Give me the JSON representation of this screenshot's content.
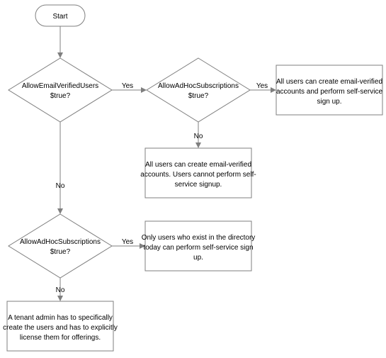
{
  "chart_data": {
    "type": "flowchart",
    "nodes": [
      {
        "id": "start",
        "kind": "terminator",
        "label": "Start"
      },
      {
        "id": "d1",
        "kind": "decision",
        "label": "AllowEmailVerifiedUsers $true?"
      },
      {
        "id": "d2",
        "kind": "decision",
        "label": "AllowAdHocSubscriptions $true?"
      },
      {
        "id": "d3",
        "kind": "decision",
        "label": "AllowAdHocSubscriptions $true?"
      },
      {
        "id": "o1",
        "kind": "outcome",
        "label": "All users can create email-verified accounts and perform self-service sign up."
      },
      {
        "id": "o2",
        "kind": "outcome",
        "label": "All users can create email-verified accounts. Users cannot perform self-service signup."
      },
      {
        "id": "o3",
        "kind": "outcome",
        "label": "Only users who exist in the directory today can perform self-service sign up."
      },
      {
        "id": "o4",
        "kind": "outcome",
        "label": "A tenant admin has to specifically create the users and has to explicitly license them for offerings."
      }
    ],
    "edges": [
      {
        "from": "start",
        "to": "d1"
      },
      {
        "from": "d1",
        "to": "d2",
        "label": "Yes"
      },
      {
        "from": "d1",
        "to": "d3",
        "label": "No"
      },
      {
        "from": "d2",
        "to": "o1",
        "label": "Yes"
      },
      {
        "from": "d2",
        "to": "o2",
        "label": "No"
      },
      {
        "from": "d3",
        "to": "o3",
        "label": "Yes"
      },
      {
        "from": "d3",
        "to": "o4",
        "label": "No"
      }
    ]
  },
  "labels": {
    "start": "Start",
    "d1_line1": "AllowEmailVerifiedUsers",
    "d1_line2": "$true?",
    "d2_line1": "AllowAdHocSubscriptions",
    "d2_line2": "$true?",
    "d3_line1": "AllowAdHocSubscriptions",
    "d3_line2": "$true?",
    "o1_line1": "All users can create email-verified",
    "o1_line2": "accounts and perform self-service",
    "o1_line3": "sign up.",
    "o2_line1": "All users can create email-verified",
    "o2_line2": "accounts. Users cannot perform self-",
    "o2_line3": "service signup.",
    "o3_line1": "Only users who exist in the directory",
    "o3_line2": "today can perform self-service sign",
    "o3_line3": "up.",
    "o4_line1": "A tenant admin has to specifically",
    "o4_line2": "create the users and has to explicitly",
    "o4_line3": "license them for offerings.",
    "yes": "Yes",
    "no": "No"
  }
}
